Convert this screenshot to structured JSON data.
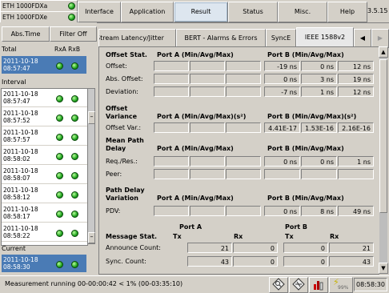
{
  "devices": [
    {
      "label": "ETH 1000FDXa"
    },
    {
      "label": "ETH 1000FDXe"
    }
  ],
  "top_tabs": [
    "Interface",
    "Application",
    "Result",
    "Status",
    "Misc.",
    "Help",
    "3.5.15"
  ],
  "left": {
    "abs_time": "Abs.Time",
    "filter_off": "Filter Off",
    "total_label": "Total",
    "rxa_rxb": "RxA RxB",
    "total_row": {
      "date": "2011-10-18",
      "time": "08:57:47"
    },
    "interval_label": "Interval",
    "interval_rows": [
      {
        "date": "2011-10-18",
        "time": "08:57:47"
      },
      {
        "date": "2011-10-18",
        "time": "08:57:52"
      },
      {
        "date": "2011-10-18",
        "time": "08:57:57"
      },
      {
        "date": "2011-10-18",
        "time": "08:58:02"
      },
      {
        "date": "2011-10-18",
        "time": "08:58:07"
      },
      {
        "date": "2011-10-18",
        "time": "08:58:12"
      },
      {
        "date": "2011-10-18",
        "time": "08:58:17"
      },
      {
        "date": "2011-10-18",
        "time": "08:58:22"
      }
    ],
    "current_label": "Current",
    "current_row": {
      "date": "2011-10-18",
      "time": "08:58:30"
    }
  },
  "sub_tabs": [
    "Stream Latency/Jitter",
    "BERT - Alarms & Errors",
    "SyncE",
    "IEEE 1588v2"
  ],
  "sections": {
    "offset": {
      "title": "Offset Stat.",
      "port_a": "Port A (Min/Avg/Max)",
      "port_b": "Port B (Min/Avg/Max)",
      "rows": [
        {
          "label": "Offset:",
          "b": [
            "-19 ns",
            "0 ns",
            "12 ns"
          ]
        },
        {
          "label": "Abs. Offset:",
          "b": [
            "0 ns",
            "3 ns",
            "19 ns"
          ]
        },
        {
          "label": "Deviation:",
          "b": [
            "-7 ns",
            "1 ns",
            "12 ns"
          ]
        }
      ]
    },
    "variance": {
      "title1": "Offset",
      "title2": "Variance",
      "port_a": "Port A (Min/Avg/Max)(s²)",
      "port_b": "Port B (Min/Avg/Max)(s²)",
      "rows": [
        {
          "label": "Offset Var.:",
          "b": [
            "4.41E-17",
            "1.53E-16",
            "2.16E-16"
          ]
        }
      ]
    },
    "mpd": {
      "title1": "Mean Path",
      "title2": "Delay",
      "port_a": "Port A (Min/Avg/Max)",
      "port_b": "Port B (Min/Avg/Max)",
      "rows": [
        {
          "label": "Req./Res.:",
          "b": [
            "0 ns",
            "0 ns",
            "1 ns"
          ]
        },
        {
          "label": "Peer:",
          "b": [
            "",
            "",
            ""
          ]
        }
      ]
    },
    "pdv": {
      "title1": "Path Delay",
      "title2": "Variation",
      "port_a": "Port A (Min/Avg/Max)",
      "port_b": "Port B (Min/Avg/Max)",
      "rows": [
        {
          "label": "PDV:",
          "b": [
            "0 ns",
            "8 ns",
            "49 ns"
          ]
        }
      ]
    },
    "msg": {
      "title": "Message Stat.",
      "port_a": "Port A",
      "port_b": "Port B",
      "tx": "Tx",
      "rx": "Rx",
      "rows": [
        {
          "label": "Announce Count:",
          "a_tx": "21",
          "a_rx": "0",
          "b_tx": "0",
          "b_rx": "21"
        },
        {
          "label": "Sync. Count:",
          "a_tx": "43",
          "a_rx": "0",
          "b_tx": "0",
          "b_rx": "43"
        }
      ]
    }
  },
  "status": {
    "text": "Measurement running 00-00:00:42 < 1% (00-03:35:10)",
    "clock": "08:58:30",
    "battery": "99%"
  },
  "colors": {
    "led_green": "#1fa31f",
    "selected_row": "#4a7bb5",
    "active_tab": "#dde6ef"
  }
}
